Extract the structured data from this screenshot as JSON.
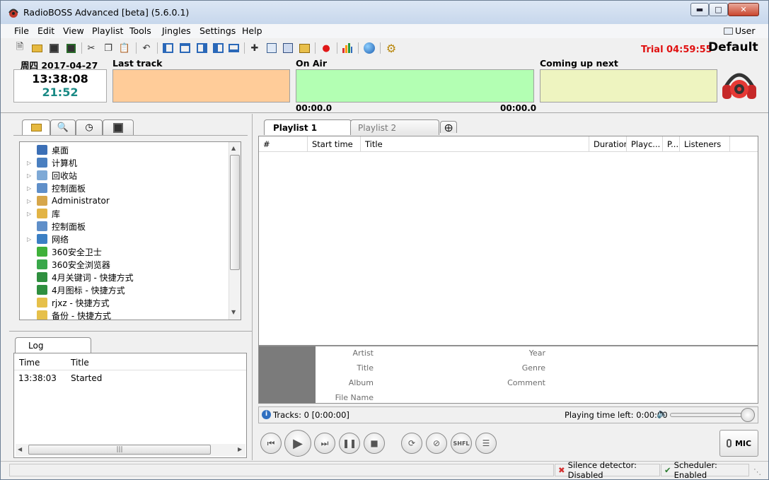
{
  "window": {
    "title": "RadioBOSS Advanced [beta] (5.6.0.1)"
  },
  "menu": {
    "items": [
      "File",
      "Edit",
      "View",
      "Playlist",
      "Tools",
      "Jingles",
      "Settings",
      "Help"
    ],
    "user": "User"
  },
  "toolbar": {
    "icons": [
      "new-icon",
      "open-icon",
      "save-icon",
      "save-as-icon",
      "cut-icon",
      "copy-icon",
      "paste-icon",
      "undo-icon",
      "layout-1-icon",
      "layout-2-icon",
      "layout-3-icon",
      "layout-4-icon",
      "layout-5-icon",
      "add-files-icon",
      "add-folder-icon",
      "insert-icon",
      "add-url-icon",
      "record-icon",
      "stats-icon",
      "globe-icon",
      "settings-gear-icon"
    ]
  },
  "header": {
    "trial": "Trial 04:59:55",
    "profile": "Default"
  },
  "info": {
    "date": "周四 2017-04-27",
    "clock": "13:38:08",
    "elapsed": "21:52",
    "last_track_label": "Last track",
    "on_air_label": "On Air",
    "next_label": "Coming up next",
    "on_air_elapsed": "00:00.0",
    "on_air_remaining": "00:00.0"
  },
  "browser": {
    "tabs": [
      "folder-icon",
      "search-icon",
      "clock-icon",
      "library-icon"
    ],
    "tree": [
      {
        "label": "桌面",
        "expandable": false,
        "color": "#3b6fb6"
      },
      {
        "label": "计算机",
        "expandable": true,
        "color": "#4a7fc0"
      },
      {
        "label": "回收站",
        "expandable": true,
        "color": "#7ea9d6"
      },
      {
        "label": "控制面板",
        "expandable": true,
        "color": "#5f8fc9"
      },
      {
        "label": "Administrator",
        "expandable": true,
        "color": "#d6a64a"
      },
      {
        "label": "库",
        "expandable": true,
        "color": "#e2b445"
      },
      {
        "label": "控制面板",
        "expandable": false,
        "color": "#5f8fc9"
      },
      {
        "label": "网络",
        "expandable": true,
        "color": "#3b7fc4"
      },
      {
        "label": "360安全卫士",
        "expandable": false,
        "color": "#3fb13a"
      },
      {
        "label": "360安全浏览器",
        "expandable": false,
        "color": "#39a84a"
      },
      {
        "label": "4月关键词 - 快捷方式",
        "expandable": false,
        "color": "#2f8f3f"
      },
      {
        "label": "4月图标 - 快捷方式",
        "expandable": false,
        "color": "#2f8f3f"
      },
      {
        "label": "rjxz - 快捷方式",
        "expandable": false,
        "color": "#e6c04a"
      },
      {
        "label": "备份 - 快捷方式",
        "expandable": false,
        "color": "#e6c04a"
      }
    ]
  },
  "log": {
    "tab": "Log",
    "columns": [
      "Time",
      "Title"
    ],
    "rows": [
      {
        "time": "13:38:03",
        "title": "Started"
      }
    ]
  },
  "playlist": {
    "tabs": [
      "Playlist 1",
      "Playlist 2"
    ],
    "columns": [
      "#",
      "Start time",
      "Title",
      "Duration",
      "Playc...",
      "P...",
      "Listeners"
    ]
  },
  "track_info": {
    "labels_left": [
      "Artist",
      "Title",
      "Album",
      "File Name"
    ],
    "labels_right": [
      "Year",
      "Genre",
      "Comment"
    ]
  },
  "status": {
    "tracks": "Tracks: 0 [0:00:00]",
    "playing_left": "Playing time left: 0:00:00",
    "volume": 1.0
  },
  "transport": {
    "mic": "MIC",
    "shuffle": "SHFL"
  },
  "statusbar": {
    "silence": "Silence detector: Disabled",
    "scheduler": "Scheduler: Enabled"
  }
}
